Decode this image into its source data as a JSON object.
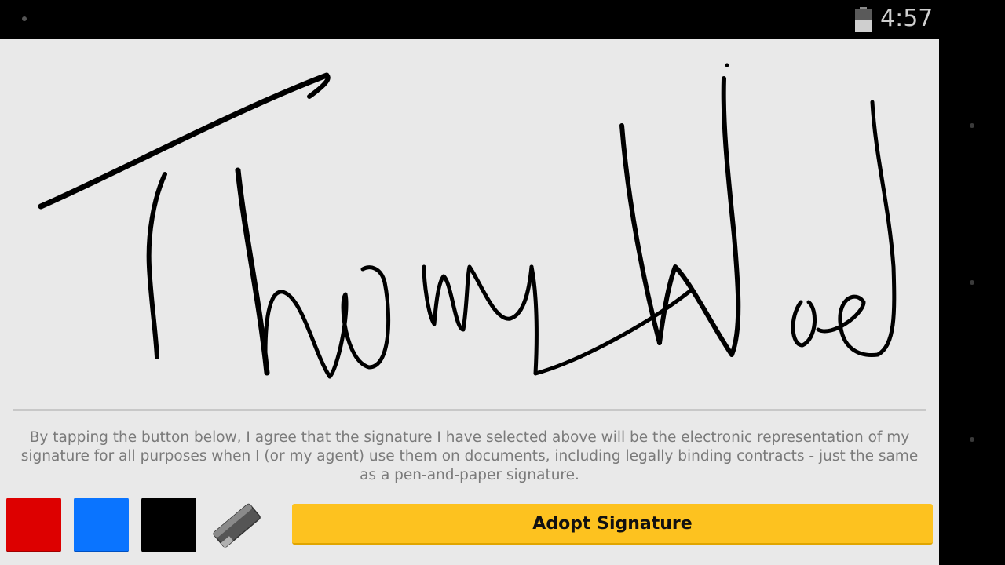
{
  "status_bar": {
    "time": "4:57",
    "icons": [
      "notification-dot",
      "battery-icon"
    ]
  },
  "signature_pad": {
    "stroke_color": "#000000",
    "background": "#e9e9e9"
  },
  "disclaimer": {
    "text": "By tapping the button below, I agree that the signature I have selected above will be the electronic representation of my signature for all purposes when I (or my agent) use them on documents, including legally binding contracts - just the same as a pen-and-paper signature."
  },
  "toolbar": {
    "colors": [
      {
        "name": "red",
        "hex": "#dd0000"
      },
      {
        "name": "blue",
        "hex": "#0a74ff"
      },
      {
        "name": "black",
        "hex": "#000000"
      }
    ],
    "eraser_icon": "eraser-icon",
    "adopt_label": "Adopt Signature",
    "adopt_color": "#fdc21f"
  }
}
